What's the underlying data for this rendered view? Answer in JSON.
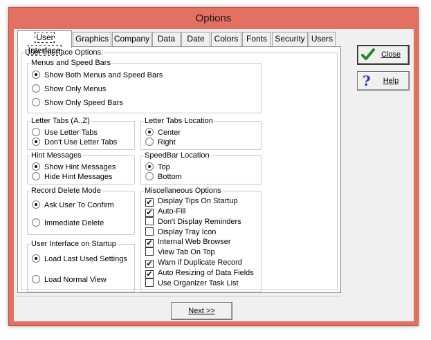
{
  "window": {
    "title": "Options"
  },
  "tabs": [
    {
      "label": "User Interface",
      "active": true
    },
    {
      "label": "Graphics",
      "active": false
    },
    {
      "label": "Company",
      "active": false
    },
    {
      "label": "Data",
      "active": false
    },
    {
      "label": "Date",
      "active": false
    },
    {
      "label": "Colors",
      "active": false
    },
    {
      "label": "Fonts",
      "active": false
    },
    {
      "label": "Security",
      "active": false
    },
    {
      "label": "Users",
      "active": false
    }
  ],
  "panel": {
    "title": "User Interface Options:",
    "menus": {
      "title": "Menus and Speed Bars",
      "options": [
        {
          "label": "Show Both Menus and Speed Bars",
          "checked": true
        },
        {
          "label": "Show Only Menus",
          "checked": false
        },
        {
          "label": "Show Only Speed Bars",
          "checked": false
        }
      ]
    },
    "letter_tabs": {
      "title": "Letter Tabs (A..Z)",
      "options": [
        {
          "label": "Use Letter Tabs",
          "checked": false
        },
        {
          "label": "Don't Use Letter Tabs",
          "checked": true
        }
      ]
    },
    "letter_tabs_location": {
      "title": "Letter Tabs Location",
      "options": [
        {
          "label": "Center",
          "checked": true
        },
        {
          "label": "Right",
          "checked": false
        }
      ]
    },
    "hint_messages": {
      "title": "Hint Messages",
      "options": [
        {
          "label": "Show Hint Messages",
          "checked": true
        },
        {
          "label": "Hide Hint Messages",
          "checked": false
        }
      ]
    },
    "speedbar_location": {
      "title": "SpeedBar Location",
      "options": [
        {
          "label": "Top",
          "checked": true
        },
        {
          "label": "Bottom",
          "checked": false
        }
      ]
    },
    "record_delete": {
      "title": "Record Delete Mode",
      "options": [
        {
          "label": "Ask User To Confirm",
          "checked": true
        },
        {
          "label": "Immediate Delete",
          "checked": false
        }
      ]
    },
    "startup": {
      "title": "User Interface on Startup",
      "options": [
        {
          "label": "Load Last Used Settings",
          "checked": true
        },
        {
          "label": "Load Normal View",
          "checked": false
        }
      ]
    },
    "misc": {
      "title": "Miscellaneous Options",
      "options": [
        {
          "label": "Display Tips On Startup",
          "checked": true
        },
        {
          "label": "Auto-Fill",
          "checked": true
        },
        {
          "label": "Don't Display Reminders",
          "checked": false
        },
        {
          "label": "Display Tray Icon",
          "checked": false
        },
        {
          "label": "Internal Web Browser",
          "checked": true
        },
        {
          "label": "View Tab On Top",
          "checked": false
        },
        {
          "label": "Warn if Duplicate Record",
          "checked": true
        },
        {
          "label": "Auto Resizing of Data Fields",
          "checked": true
        },
        {
          "label": "Use Organizer Task List",
          "checked": false
        }
      ]
    }
  },
  "buttons": {
    "close": {
      "label": "Close",
      "icon": "checkmark-icon"
    },
    "help": {
      "label": "Help",
      "icon": "question-mark-icon"
    },
    "next": {
      "label": "Next >>"
    }
  },
  "colors": {
    "title_bar": "#e37060",
    "check_green": "#1e8a1e",
    "help_blue": "#1f3fa8"
  }
}
